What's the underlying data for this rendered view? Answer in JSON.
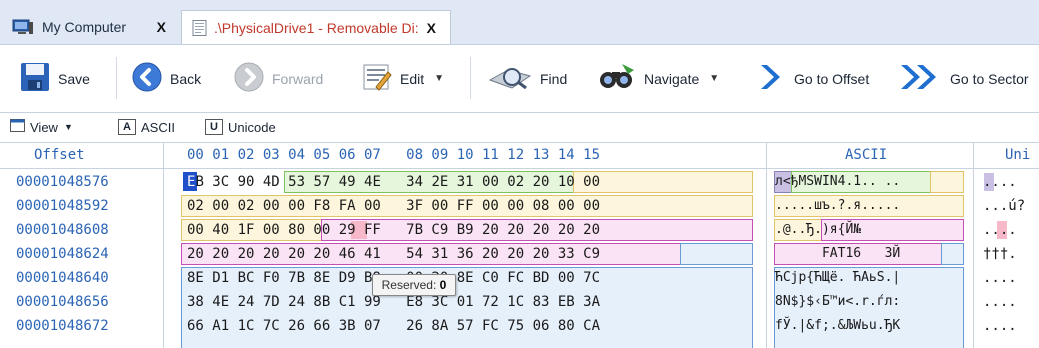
{
  "tabs": [
    {
      "label": "My Computer",
      "close": "X"
    },
    {
      "label": ".\\PhysicalDrive1 - Removable Di:",
      "close": "X"
    }
  ],
  "toolbar": {
    "save": "Save",
    "back": "Back",
    "forward": "Forward",
    "edit": "Edit",
    "find": "Find",
    "navigate": "Navigate",
    "goto_offset": "Go to Offset",
    "goto_sector": "Go to Sector"
  },
  "viewbar": {
    "view": "View",
    "ascii_key": "A",
    "ascii": "ASCII",
    "unicode_key": "U",
    "unicode": "Unicode"
  },
  "grid": {
    "offset_header": "Offset",
    "hex_header": "00 01 02 03 04 05 06 07   08 09 10 11 12 13 14 15",
    "ascii_header": "ASCII",
    "unicode_header": "Uni",
    "rows": [
      {
        "offset": "00001048576",
        "hex": "EB 3C 90 4D 53 57 49 4E   34 2E 31 00 02 20 10 00",
        "ascii": "л<ђMSWIN4.1.. ..",
        "uni": "...."
      },
      {
        "offset": "00001048592",
        "hex": "02 00 02 00 00 F8 FA 00   3F 00 FF 00 00 08 00 00",
        "ascii": ".....шъ.?.я.....",
        "uni": "...ú?"
      },
      {
        "offset": "00001048608",
        "hex": "00 40 1F 00 80 00 29 FF   7B C9 B9 20 20 20 20 20",
        "ascii": ".@..Ђ.)я{Й№     ",
        "uni": "...."
      },
      {
        "offset": "00001048624",
        "hex": "20 20 20 20 20 20 46 41   54 31 36 20 20 20 33 C9",
        "ascii": "      FAT16   3Й",
        "uni": "†††."
      },
      {
        "offset": "00001048640",
        "hex": "8E D1 BC F0 7B 8E D9 B8   00 20 8E C0 FC BD 00 7C",
        "ascii": "ЋСјр{ЋЩё. ЋАьЅ.|",
        "uni": "...."
      },
      {
        "offset": "00001048656",
        "hex": "38 4E 24 7D 24 8B C1 99   E8 3C 01 72 1C 83 EB 3A",
        "ascii": "8N$}$‹Б™и<.r.ѓл:",
        "uni": "...."
      },
      {
        "offset": "00001048672",
        "hex": "66 A1 1C 7C 26 66 3B 07   26 8A 57 FC 75 06 80 CA",
        "ascii": "fЎ.|&f;.&ЉWьu.ЂК",
        "uni": "...."
      }
    ]
  },
  "tooltip": {
    "label": "Reserved:",
    "value": "0"
  },
  "colors": {
    "offset": "#2b64b5",
    "selection": "#1f4fc9",
    "green": "#e6f6dc",
    "yellow": "#fdf6dc",
    "pink": "#fbe3f6",
    "blue": "#e6f0fb"
  }
}
